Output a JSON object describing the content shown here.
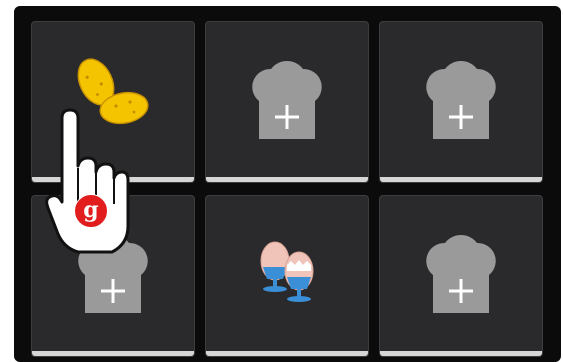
{
  "tiles": [
    {
      "icon": "potatoes-icon",
      "state": "filled"
    },
    {
      "icon": "chef-hat-add-icon",
      "state": "empty"
    },
    {
      "icon": "chef-hat-add-icon",
      "state": "empty"
    },
    {
      "icon": "chef-hat-add-icon",
      "state": "empty"
    },
    {
      "icon": "boiled-eggs-icon",
      "state": "filled"
    },
    {
      "icon": "chef-hat-add-icon",
      "state": "empty"
    }
  ],
  "cursor": {
    "icon": "pointing-hand-cursor-icon",
    "badge_text": "g",
    "badge_color": "#e11d1d"
  },
  "colors": {
    "background": "#0b0b0b",
    "tile": "#2a2a2c",
    "hat": "#9a9a9a",
    "tile_bar": "#d6d6d6"
  }
}
